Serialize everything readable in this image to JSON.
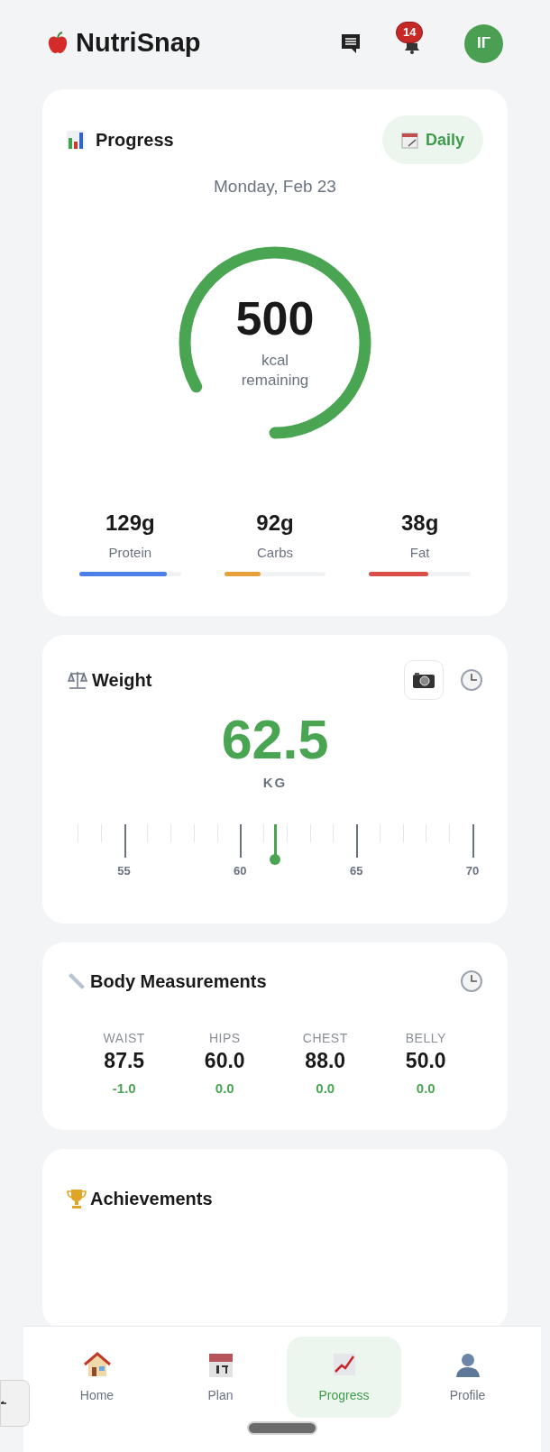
{
  "header": {
    "title": "NutriSnap",
    "notification_count": "14",
    "avatar_initials": "IΓ"
  },
  "progress": {
    "title": "Progress",
    "period_button": "Daily",
    "date": "Monday, Feb 23",
    "ring": {
      "level": 0.83,
      "value": "500",
      "unit": "kcal",
      "caption": "remaining"
    },
    "macros": [
      {
        "amount": "129g",
        "name": "Protein",
        "level": 0.86,
        "color": "#4a80e8"
      },
      {
        "amount": "92g",
        "name": "Carbs",
        "level": 0.36,
        "color": "#e8a03a"
      },
      {
        "amount": "38g",
        "name": "Fat",
        "level": 0.58,
        "color": "#dc4d48"
      }
    ]
  },
  "weight": {
    "title": "Weight",
    "value": "62.5",
    "unit": "KG",
    "scale": {
      "level": 0.5,
      "labels": [
        "55",
        "60",
        "65",
        "70"
      ]
    }
  },
  "measurements": {
    "title": "Body Measurements",
    "items": [
      {
        "name": "WAIST",
        "value": "87.5",
        "change": "-1.0"
      },
      {
        "name": "HIPS",
        "value": "60.0",
        "change": "0.0"
      },
      {
        "name": "CHEST",
        "value": "88.0",
        "change": "0.0"
      },
      {
        "name": "BELLY",
        "value": "50.0",
        "change": "0.0"
      }
    ]
  },
  "achievements": {
    "title": "Achievements"
  },
  "nav": [
    {
      "label": "Home",
      "kind": "home",
      "selected": false
    },
    {
      "label": "Plan",
      "kind": "plan",
      "selected": false
    },
    {
      "label": "Progress",
      "kind": "progress",
      "selected": true
    },
    {
      "label": "Profile",
      "kind": "profile",
      "selected": false
    }
  ]
}
